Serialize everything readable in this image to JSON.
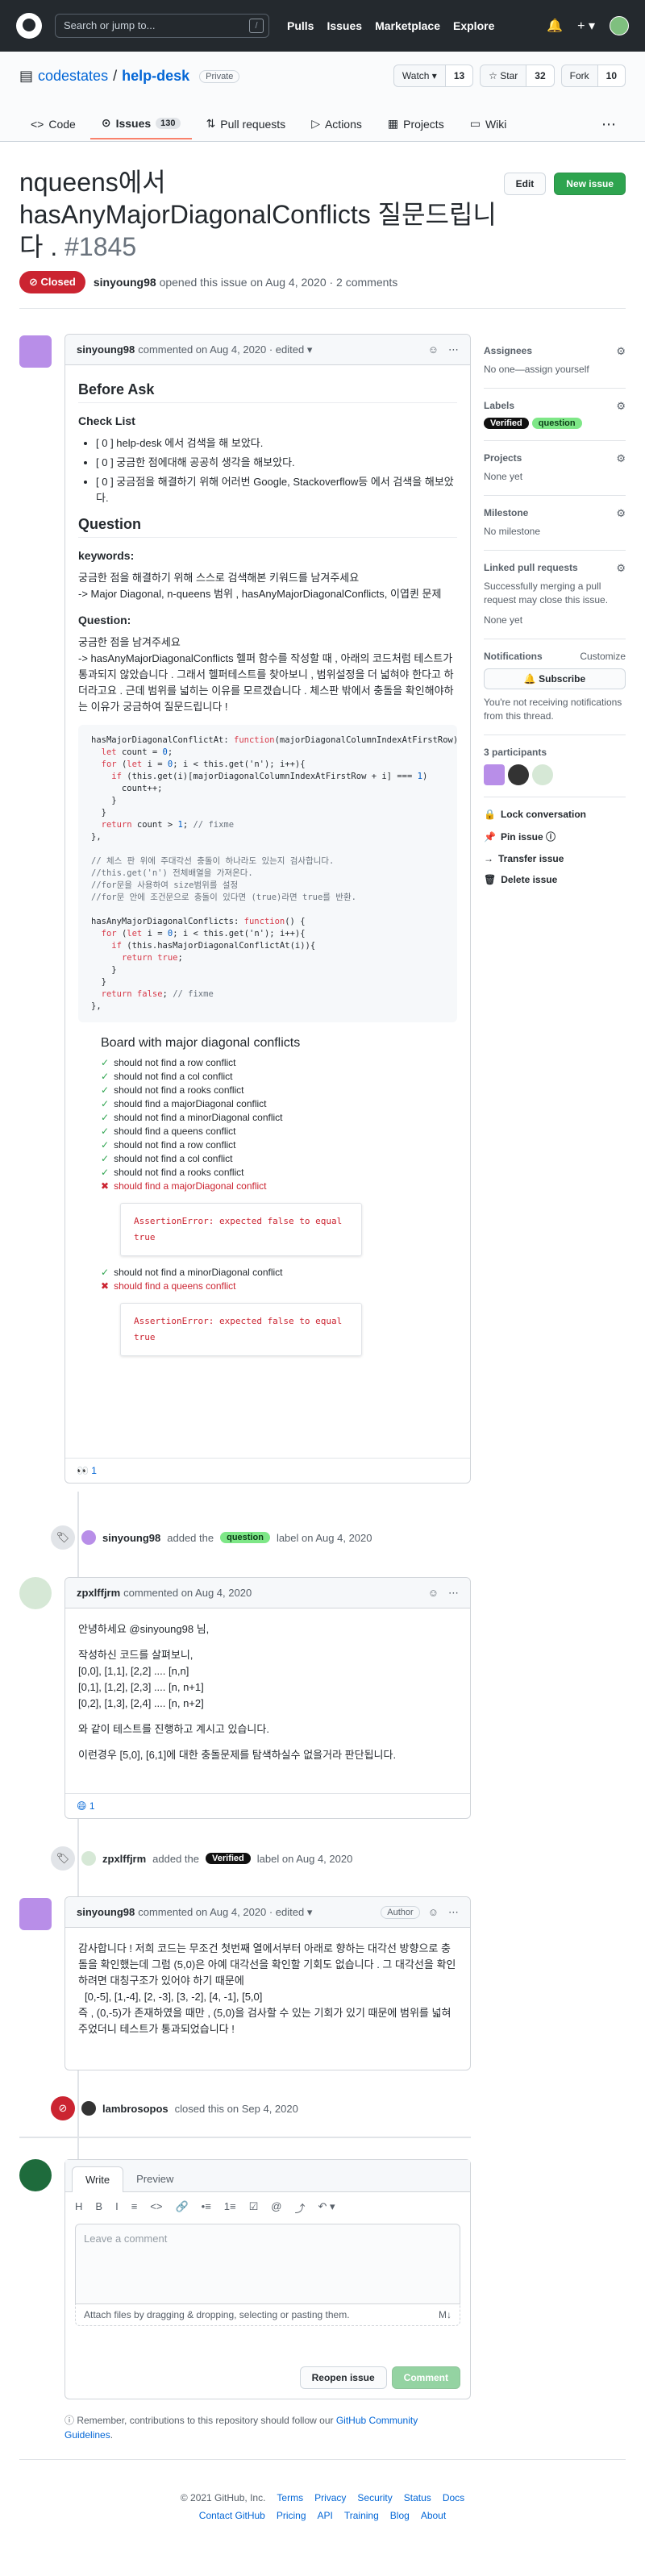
{
  "colors": {
    "header_bg": "#24292e",
    "closed_red": "#cb2431",
    "green": "#2ea44f",
    "link_blue": "#0366d6",
    "label_question": "#7ee787",
    "label_verified": "#111111"
  },
  "header": {
    "search_placeholder": "Search or jump to...",
    "search_key": "/",
    "nav": [
      "Pulls",
      "Issues",
      "Marketplace",
      "Explore"
    ],
    "icons": {
      "bell": "🔔",
      "plus": "+ ▾"
    }
  },
  "repo": {
    "owner": "codestates",
    "separator": "/",
    "name": "help-desk",
    "visibility": "Private",
    "watch_label": "Watch ▾",
    "watch_count": "13",
    "star_label": "☆ Star",
    "star_count": "32",
    "fork_label": "Fork",
    "fork_count": "10",
    "tabs": [
      {
        "label": "Code",
        "icon": "<>"
      },
      {
        "label": "Issues",
        "icon": "⊙",
        "counter": "130"
      },
      {
        "label": "Pull requests",
        "icon": "⇅"
      },
      {
        "label": "Actions",
        "icon": "▷"
      },
      {
        "label": "Projects",
        "icon": "▦"
      },
      {
        "label": "Wiki",
        "icon": "▭"
      }
    ]
  },
  "issue": {
    "title": "nqueens에서 hasAnyMajorDiagonalConflicts 질문드립니다 .",
    "number": "#1845",
    "edit_label": "Edit",
    "new_issue_label": "New issue",
    "state": "Closed",
    "state_icon": "⊘",
    "author": "sinyoung98",
    "meta": "opened this issue on Aug 4, 2020 · 2 comments"
  },
  "comment1": {
    "author": "sinyoung98",
    "meta": "commented on Aug 4, 2020 · edited ▾",
    "h_before": "Before Ask",
    "h_check": "Check List",
    "checklist": [
      "[ 0 ] help-desk 에서 검색을 해 보았다.",
      "[ 0 ] 궁금한 점에대해 공공히 생각을 해보았다.",
      "[ 0 ] 궁금점을 해결하기 위해 어러번 Google, Stackoverflow등 에서 검색을 해보았다."
    ],
    "h_question": "Question",
    "keywords_label": "keywords:",
    "keywords_text": "궁금한 점을 해결하기 위해 스스로 검색해본 키워드를 남겨주세요",
    "keywords_line": "-> Major Diagonal, n-queens 범위 ,   hasAnyMajorDiagonalConflicts,   이엽퀸 문제",
    "question_label": "Question:",
    "question_text1": "궁금한 점을 남겨주세요",
    "question_text2": "-> hasAnyMajorDiagonalConflicts 헬퍼 함수를 작성할 때 , 아래의 코드처럼 테스트가 통과되지 않았습니다 .  그래서 헬퍼테스트를 찾아보니 , 범위설정을 더 넓혀야 한다고 하더라고요 .  근데 범위를 넓히는 이유를 모르겠습니다 .  체스판 밖에서 충돌을 확인해야하는 이유가 궁금하여 질문드립니다 !",
    "code": [
      "hasMajorDiagonalConflictAt: function(majorDiagonalColumnIndexAtFirstRow) {",
      "  let count = 0;",
      "  for (let i = 0; i < this.get('n'); i++){",
      "    if (this.get(i)[majorDiagonalColumnIndexAtFirstRow + i] === 1)",
      "      count++;",
      "    }",
      "  }",
      "  return count > 1; // fixme",
      "},",
      "",
      "// 체스 판 위에 주대각선 충돌이 하나라도 있는지 검사합니다.",
      "//this.get('n') 전체배열을 가져온다.",
      "//for문을 사용하여 size범위를 설정",
      "//for문 안에 조건문으로 충돌이 있다면 (true)라면 true를 반환.",
      "",
      "hasAnyMajorDiagonalConflicts: function() {",
      "  for (let i = 0; i < this.get('n'); i++){",
      "    if (this.hasMajorDiagonalConflictAt(i)){",
      "      return true;",
      "    }",
      "  }",
      "  return false; // fixme",
      "},"
    ],
    "test_title": "Board with major diagonal conflicts",
    "tests_a": [
      {
        "text": "should not find a row conflict",
        "status": "pass"
      },
      {
        "text": "should not find a col conflict",
        "status": "pass"
      },
      {
        "text": "should not find a rooks conflict",
        "status": "pass"
      },
      {
        "text": "should find a majorDiagonal conflict",
        "status": "pass"
      },
      {
        "text": "should not find a minorDiagonal conflict",
        "status": "pass"
      },
      {
        "text": "should find a queens conflict",
        "status": "pass"
      },
      {
        "text": "should not find a row conflict",
        "status": "pass"
      },
      {
        "text": "should not find a col conflict",
        "status": "pass"
      },
      {
        "text": "should not find a rooks conflict",
        "status": "pass"
      },
      {
        "text": "should find a majorDiagonal conflict",
        "status": "fail"
      }
    ],
    "assertion": "AssertionError: expected false to equal true",
    "tests_b": [
      {
        "text": "should not find a minorDiagonal conflict",
        "status": "pass"
      },
      {
        "text": "should find a queens conflict",
        "status": "fail"
      }
    ],
    "reaction": "👀 1"
  },
  "event_label": {
    "author": "sinyoung98",
    "before": "added the",
    "label": "question",
    "after": "label on Aug 4, 2020"
  },
  "comment2": {
    "author": "zpxlffjrm",
    "meta": "commented on Aug 4, 2020",
    "greeting": "안녕하세요 @sinyoung98 님,",
    "lines": [
      "작성하신 코드를 살펴보니,",
      "[0,0], [1,1], [2,2] .... [n,n]",
      "[0,1], [1,2], [2,3] .... [n, n+1]",
      "[0,2], [1,3], [2,4] .... [n, n+2]"
    ],
    "p2": "와 같이 테스트를 진행하고 계시고 있습니다.",
    "p3": "이런경우 [5,0], [6,1]에 대한 충돌문제를 탐색하실수 없을거라 판단됩니다.",
    "reaction": "😄 1"
  },
  "event_verified": {
    "author": "zpxlffjrm",
    "before": "added the",
    "label": "Verified",
    "after": "label on Aug 4, 2020"
  },
  "comment3": {
    "author": "sinyoung98",
    "meta": "commented on Aug 4, 2020 · edited ▾",
    "badge": "Author",
    "text1": "감사합니다 ! 저희 코드는 무조건 첫번째 열에서부터 아래로 향하는 대각선 방향으로 충돌을 확인했는데 그럼 (5,0)은 아예 대각선을 확인할 기회도 없습니다 . 그 대각선을 확인하려면 대칭구조가 있어야 하기 때문에",
    "text2": "[0,-5], [1,-4], [2, -3], [3, -2], [4, -1], [5,0]",
    "text3": "즉 , (0,-5)가 존재하였을 때만 , (5,0)을 검사할 수 있는 기회가 있기 때문에 범위를 넓혀주었더니 테스트가 통과되었습니다 !"
  },
  "event_closed": {
    "author": "lambrosopos",
    "text": "closed this on Sep 4, 2020"
  },
  "sidebar": {
    "assignees_title": "Assignees",
    "assignees_text": "No one—assign yourself",
    "labels_title": "Labels",
    "labels": [
      "Verified",
      "question"
    ],
    "projects_title": "Projects",
    "projects_text": "None yet",
    "milestone_title": "Milestone",
    "milestone_text": "No milestone",
    "linked_title": "Linked pull requests",
    "linked_text": "Successfully merging a pull request may close this issue.",
    "linked_none": "None yet",
    "notifications_title": "Notifications",
    "customize": "Customize",
    "subscribe": "🔔 Subscribe",
    "notif_text": "You're not receiving notifications from this thread.",
    "participants_title": "3 participants",
    "actions": [
      {
        "icon": "🔒",
        "label": "Lock conversation"
      },
      {
        "icon": "📌",
        "label": "Pin issue ⓘ"
      },
      {
        "icon": "→",
        "label": "Transfer issue"
      },
      {
        "icon": "🗑",
        "label": "Delete issue"
      }
    ]
  },
  "new_comment": {
    "tab_write": "Write",
    "tab_preview": "Preview",
    "toolbar": [
      "H",
      "B",
      "I",
      "≡",
      "<>",
      "🔗",
      "•≡",
      "1≡",
      "☑",
      "@",
      "⤴",
      "↶ ▾"
    ],
    "placeholder": "Leave a comment",
    "attach": "Attach files by dragging & dropping, selecting or pasting them.",
    "markdown_icon": "M↓",
    "reopen": "Reopen issue",
    "comment": "Comment"
  },
  "remember": {
    "prefix": "ⓘ Remember, contributions to this repository should follow our",
    "link": "GitHub Community Guidelines",
    "suffix": "."
  },
  "footer": {
    "row1": [
      "© 2021 GitHub, Inc.",
      "Terms",
      "Privacy",
      "Security",
      "Status",
      "Docs"
    ],
    "row2": [
      "Contact GitHub",
      "Pricing",
      "API",
      "Training",
      "Blog",
      "About"
    ]
  }
}
